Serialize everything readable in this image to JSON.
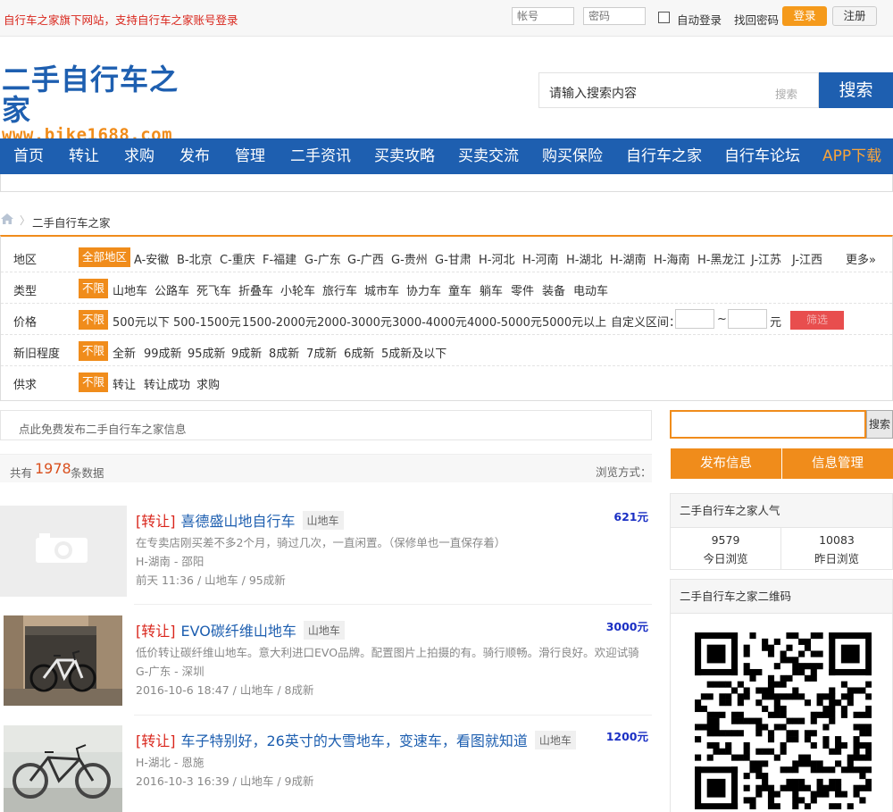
{
  "topbar": {
    "notice": "自行车之家旗下网站，支持自行车之家账号登录",
    "account_placeholder": "帐号",
    "password_placeholder": "密码",
    "auto_login": "自动登录",
    "forgot_password": "找回密码",
    "login": "登录",
    "register": "注册"
  },
  "logo": {
    "title": "二手自行车之家",
    "url": "www.bike1688.com"
  },
  "header_search": {
    "placeholder": "请输入搜索内容",
    "hint": "搜索",
    "button": "搜索"
  },
  "nav": {
    "items": [
      "首页",
      "转让",
      "求购",
      "发布",
      "管理",
      "二手资讯",
      "买卖攻略",
      "买卖交流",
      "购买保险",
      "自行车之家",
      "自行车论坛"
    ],
    "app": "APP下载",
    "app_color": "#f8a43a"
  },
  "breadcrumb": {
    "current": "二手自行车之家"
  },
  "filters": {
    "region": {
      "label": "地区",
      "selected": "全部地区",
      "options": [
        "A-安徽",
        "B-北京",
        "C-重庆",
        "F-福建",
        "G-广东",
        "G-广西",
        "G-贵州",
        "G-甘肃",
        "H-河北",
        "H-河南",
        "H-湖北",
        "H-湖南",
        "H-海南",
        "H-黑龙江",
        "J-江苏",
        "J-江西"
      ],
      "more": "更多»"
    },
    "type": {
      "label": "类型",
      "selected": "不限",
      "options": [
        "山地车",
        "公路车",
        "死飞车",
        "折叠车",
        "小轮车",
        "旅行车",
        "城市车",
        "协力车",
        "童车",
        "躺车",
        "零件",
        "装备",
        "电动车"
      ]
    },
    "price": {
      "label": "价格",
      "selected": "不限",
      "options": [
        "500元以下",
        "500-1500元",
        "1500-2000元",
        "2000-3000元",
        "3000-4000元",
        "4000-5000元",
        "5000元以上"
      ],
      "custom_label": "自定义区间：",
      "tilde": "~",
      "unit": "元",
      "filter_button": "筛选"
    },
    "condition": {
      "label": "新旧程度",
      "selected": "不限",
      "options": [
        "全新",
        "99成新",
        "95成新",
        "9成新",
        "8成新",
        "7成新",
        "6成新",
        "5成新及以下"
      ]
    },
    "supply": {
      "label": "供求",
      "selected": "不限",
      "options": [
        "转让",
        "转让成功",
        "求购"
      ]
    }
  },
  "publish_prompt": "点此免费发布二手自行车之家信息",
  "count": {
    "prefix": "共有",
    "number": "1978",
    "suffix": "条数据",
    "view_mode": "浏览方式："
  },
  "listings": [
    {
      "tag": "[转让]",
      "title": "喜德盛山地自行车",
      "category": "山地车",
      "price": "621元",
      "desc": "在专卖店刚买差不多2个月，骑过几次，一直闲置。（保修单也一直保存着）",
      "location": "H-湖南 - 邵阳",
      "meta": "前天 11:36 / 山地车 / 95成新"
    },
    {
      "tag": "[转让]",
      "title": "EVO碳纤维山地车",
      "category": "山地车",
      "price": "3000元",
      "desc": "低价转让碳纤维山地车。意大利进口EVO品牌。配置图片上拍摄的有。骑行顺畅。滑行良好。欢迎试骑",
      "location": "G-广东 - 深圳",
      "meta": "2016-10-6 18:47 / 山地车 / 8成新"
    },
    {
      "tag": "[转让]",
      "title": "车子特别好，26英寸的大雪地车，变速车，看图就知道",
      "category": "山地车",
      "price": "1200元",
      "desc": "",
      "location": "H-湖北 - 恩施",
      "meta": "2016-10-3 16:39 / 山地车 / 9成新"
    }
  ],
  "sidebar": {
    "search_button": "搜索",
    "publish": "发布信息",
    "manage": "信息管理",
    "popularity": {
      "title": "二手自行车之家人气",
      "today_value": "9579",
      "today_label": "今日浏览",
      "yesterday_value": "10083",
      "yesterday_label": "昨日浏览"
    },
    "qrcode_title": "二手自行车之家二维码"
  },
  "colors": {
    "brand_blue": "#1e5fb0",
    "accent_orange": "#f08c1b",
    "tag_red": "#d9261c",
    "price_blue": "#1a2fc4"
  }
}
